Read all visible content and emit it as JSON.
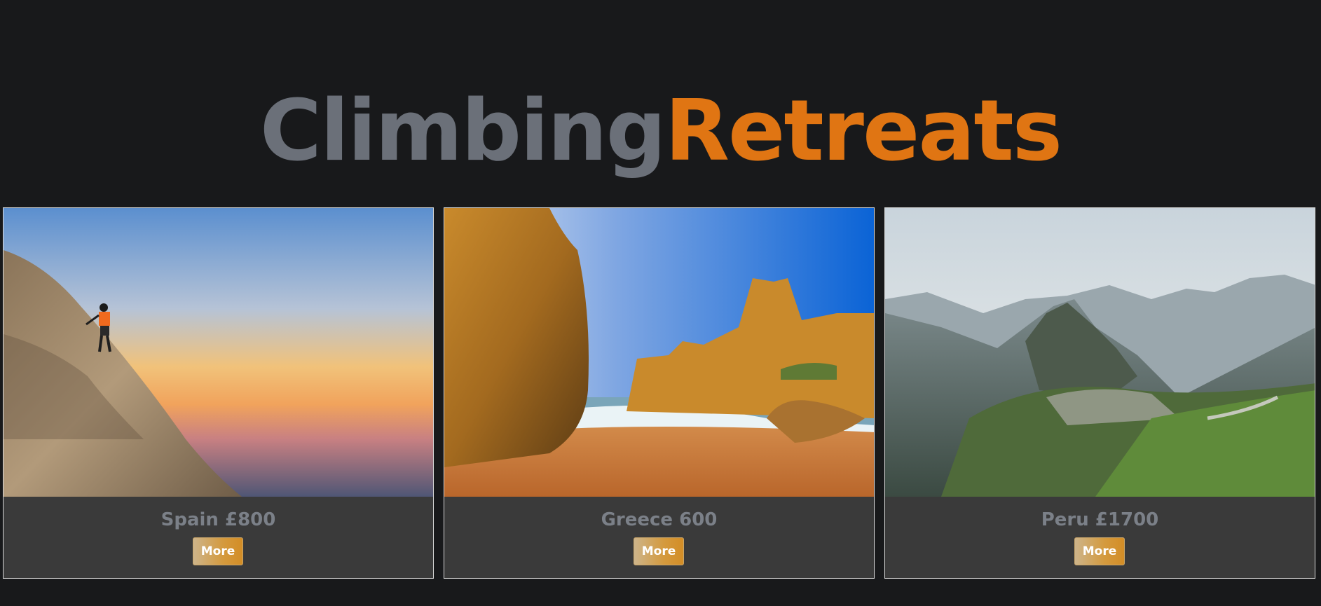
{
  "header": {
    "title_part1": "Climbing",
    "title_part2": "Retreats",
    "colors": {
      "part1": "#6b7079",
      "part2": "#e07513"
    }
  },
  "retreats": [
    {
      "caption": "Spain £800",
      "button_label": "More",
      "photo": "climber-on-cliff-at-sunset"
    },
    {
      "caption": "Greece 600",
      "button_label": "More",
      "photo": "golden-sea-cliffs-beach"
    },
    {
      "caption": "Peru £1700",
      "button_label": "More",
      "photo": "machu-picchu-mountains"
    }
  ]
}
